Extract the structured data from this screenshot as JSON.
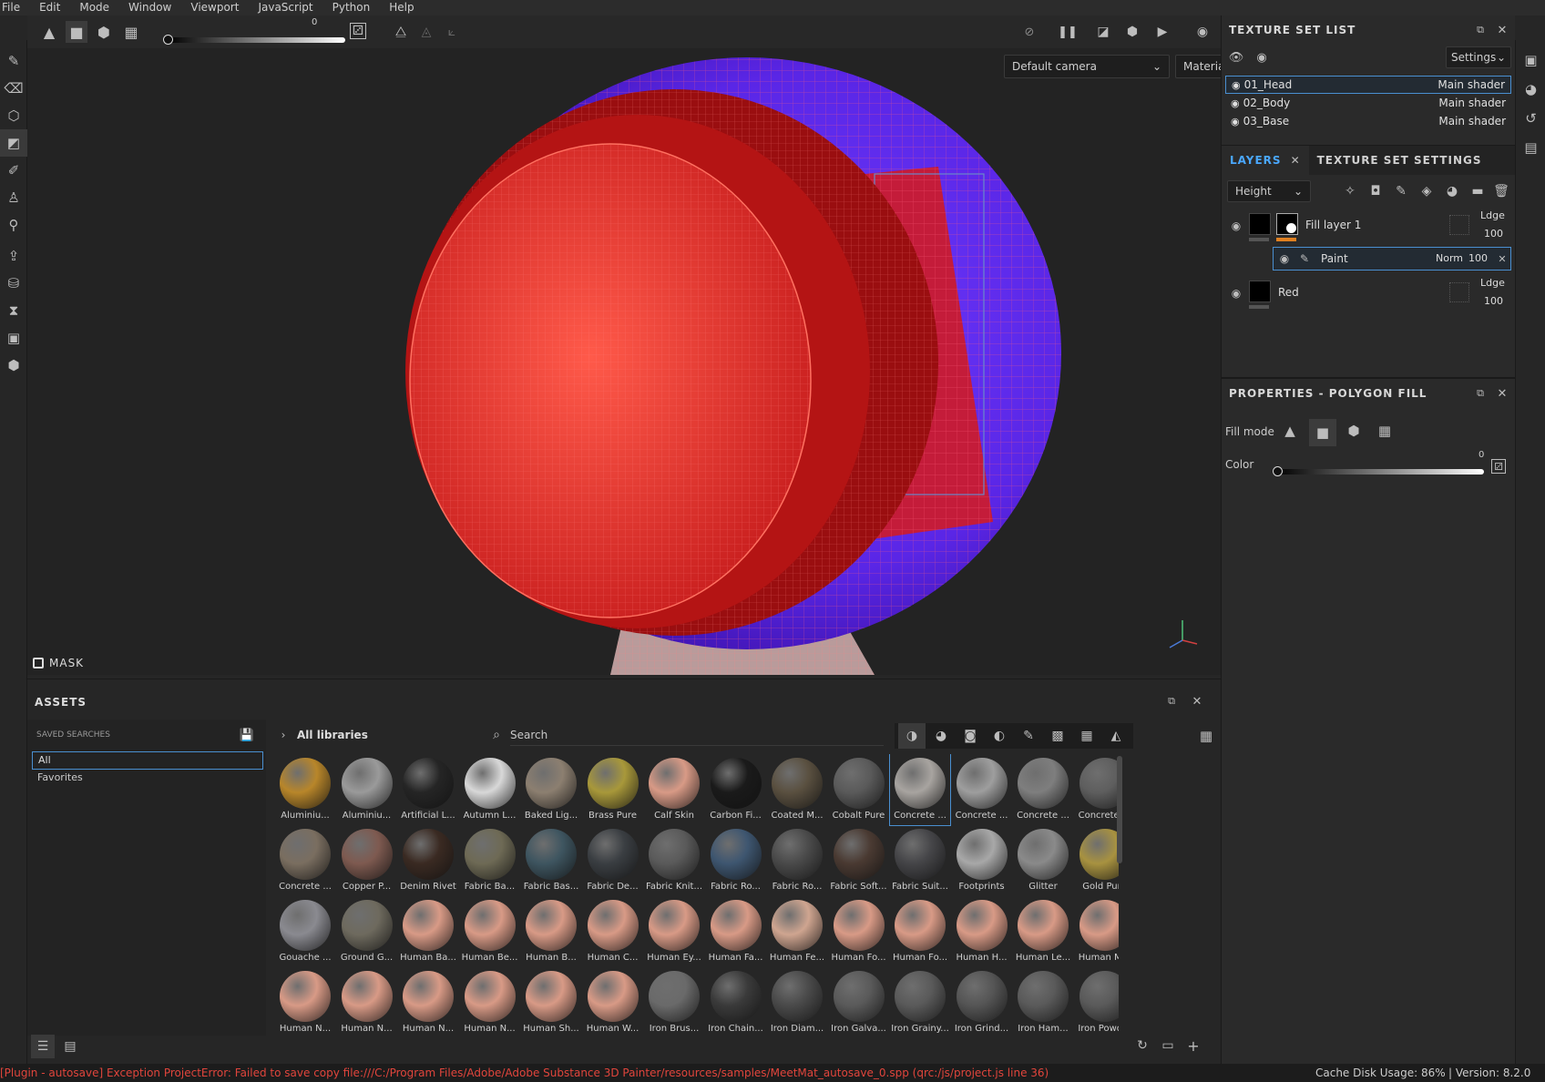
{
  "menu": [
    "File",
    "Edit",
    "Mode",
    "Window",
    "Viewport",
    "JavaScript",
    "Python",
    "Help"
  ],
  "toolbar": {
    "slider_value": "0"
  },
  "viewport": {
    "camera_select": "Default camera",
    "mode_select": "Material",
    "mask_label": "MASK"
  },
  "texture_set_list": {
    "title": "TEXTURE SET LIST",
    "settings_label": "Settings",
    "sets": [
      {
        "name": "01_Head",
        "shader": "Main shader"
      },
      {
        "name": "02_Body",
        "shader": "Main shader"
      },
      {
        "name": "03_Base",
        "shader": "Main shader"
      }
    ]
  },
  "layers_panel": {
    "tab_layers": "LAYERS",
    "tab_settings": "TEXTURE SET SETTINGS",
    "channel_select": "Height",
    "layers": [
      {
        "name": "Fill layer 1",
        "blend": "Ldge",
        "opacity": "100"
      },
      {
        "name": "Paint",
        "blend": "Norm",
        "opacity": "100"
      },
      {
        "name": "Red",
        "blend": "Ldge",
        "opacity": "100"
      }
    ]
  },
  "properties": {
    "title": "PROPERTIES - POLYGON FILL",
    "fill_mode_label": "Fill mode",
    "color_label": "Color",
    "color_value": "0"
  },
  "assets": {
    "title": "ASSETS",
    "saved_searches_label": "SAVED SEARCHES",
    "searches": [
      "All",
      "Favorites"
    ],
    "breadcrumb": "All libraries",
    "search_placeholder": "Search",
    "items": [
      {
        "label": "Aluminiu...",
        "color": "#b8862a"
      },
      {
        "label": "Aluminiu...",
        "color": "#9a9a9a"
      },
      {
        "label": "Artificial L...",
        "color": "#252525"
      },
      {
        "label": "Autumn L...",
        "color": "#d8d8d8"
      },
      {
        "label": "Baked Lig...",
        "color": "#8c7f70"
      },
      {
        "label": "Brass Pure",
        "color": "#a8983a"
      },
      {
        "label": "Calf Skin",
        "color": "#d89a86"
      },
      {
        "label": "Carbon Fi...",
        "color": "#1a1a1a"
      },
      {
        "label": "Coated M...",
        "color": "#5a5040"
      },
      {
        "label": "Cobalt Pure",
        "color": "#5a5a5a"
      },
      {
        "label": "Concrete ...",
        "color": "#a8a4a0"
      },
      {
        "label": "Concrete ...",
        "color": "#9e9e9e"
      },
      {
        "label": "Concrete ...",
        "color": "#7e7e7e"
      },
      {
        "label": "Concrete ...",
        "color": "#5e5e5e"
      },
      {
        "label": "Concrete ...",
        "color": "#7a6e60"
      },
      {
        "label": "Copper P...",
        "color": "#7e5a50"
      },
      {
        "label": "Denim Rivet",
        "color": "#3a2a22"
      },
      {
        "label": "Fabric Ba...",
        "color": "#6e6a55"
      },
      {
        "label": "Fabric Bas...",
        "color": "#3e5560"
      },
      {
        "label": "Fabric De...",
        "color": "#3a3e42"
      },
      {
        "label": "Fabric Knit...",
        "color": "#5a5a5a"
      },
      {
        "label": "Fabric Ro...",
        "color": "#3e5670"
      },
      {
        "label": "Fabric Ro...",
        "color": "#4a4a4a"
      },
      {
        "label": "Fabric Soft...",
        "color": "#4a3a32"
      },
      {
        "label": "Fabric Suit...",
        "color": "#454548"
      },
      {
        "label": "Footprints",
        "color": "#a8a8a8"
      },
      {
        "label": "Glitter",
        "color": "#8a8a8a"
      },
      {
        "label": "Gold Pure",
        "color": "#a89240"
      },
      {
        "label": "Gouache ...",
        "color": "#8a8a90"
      },
      {
        "label": "Ground G...",
        "color": "#6e6a5e"
      },
      {
        "label": "Human Ba...",
        "color": "#d89a86"
      },
      {
        "label": "Human Be...",
        "color": "#d89a86"
      },
      {
        "label": "Human B...",
        "color": "#d89a86"
      },
      {
        "label": "Human C...",
        "color": "#d89a86"
      },
      {
        "label": "Human Ey...",
        "color": "#d89a86"
      },
      {
        "label": "Human Fa...",
        "color": "#d89a86"
      },
      {
        "label": "Human Fe...",
        "color": "#cfa590"
      },
      {
        "label": "Human Fo...",
        "color": "#d89a86"
      },
      {
        "label": "Human Fo...",
        "color": "#d89a86"
      },
      {
        "label": "Human H...",
        "color": "#d89a86"
      },
      {
        "label": "Human Le...",
        "color": "#d89a86"
      },
      {
        "label": "Human M...",
        "color": "#d89a86"
      },
      {
        "label": "Human N...",
        "color": "#d89a86"
      },
      {
        "label": "Human N...",
        "color": "#d89a86"
      },
      {
        "label": "Human N...",
        "color": "#d89a86"
      },
      {
        "label": "Human N...",
        "color": "#d89a86"
      },
      {
        "label": "Human Sh...",
        "color": "#d89a86"
      },
      {
        "label": "Human W...",
        "color": "#d89a86"
      },
      {
        "label": "Iron Brus...",
        "color": "#6a6a6a"
      },
      {
        "label": "Iron Chain...",
        "color": "#3a3a3a"
      },
      {
        "label": "Iron Diam...",
        "color": "#4a4a4a"
      },
      {
        "label": "Iron Galva...",
        "color": "#5a5a5a"
      },
      {
        "label": "Iron Grainy...",
        "color": "#5a5a5a"
      },
      {
        "label": "Iron Grind...",
        "color": "#555555"
      },
      {
        "label": "Iron Ham...",
        "color": "#5a5a5a"
      },
      {
        "label": "Iron Powd...",
        "color": "#5a5a5a"
      }
    ]
  },
  "status": {
    "error": "[Plugin - autosave] Exception ProjectError: Failed to save copy file:///C:/Program Files/Adobe/Adobe Substance 3D Painter/resources/samples/MeetMat_autosave_0.spp (qrc:/js/project.js line 36)",
    "cache": "Cache Disk Usage:",
    "cache_value": "86%",
    "version": "| Version: 8.2.0"
  }
}
